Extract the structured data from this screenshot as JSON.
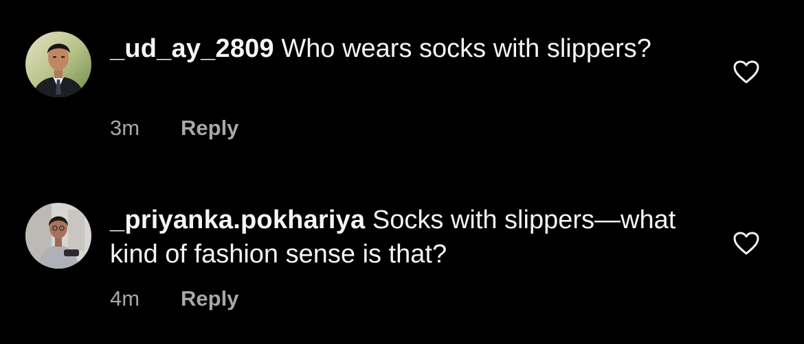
{
  "comments": [
    {
      "username": "_ud_ay_2809",
      "text": "Who wears socks with slippers?",
      "time": "3m",
      "reply_label": "Reply",
      "like_icon": "heart-outline-icon",
      "avatar_icon": "user-avatar"
    },
    {
      "username": "_priyanka.pokhariya",
      "text": "Socks with slippers—what kind of fashion sense is that?",
      "time": "4m",
      "reply_label": "Reply",
      "like_icon": "heart-outline-icon",
      "avatar_icon": "user-avatar"
    }
  ],
  "colors": {
    "background": "#000000",
    "text": "#f5f5f5",
    "secondary": "#a8a8a8"
  }
}
